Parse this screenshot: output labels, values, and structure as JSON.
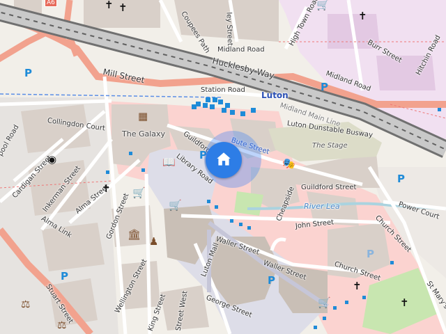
{
  "map": {
    "streets": {
      "coupees_path": "Coupees Path",
      "midland_road_north": "Midland Road",
      "high_town_road": "High Town Road",
      "burr_street": "Burr Street",
      "hitchin_road": "Hitchin Road",
      "hucklesby_way": "Hucklesby Way",
      "midland_road_east": "Midland Road",
      "mill_street": "Mill Street",
      "station_road": "Station Road",
      "midland_main_line": "Midland Main Line",
      "collingdon_court": "Collingdon Court",
      "guildford_street_west": "Guildford Street",
      "bute_street": "Bute Street",
      "luton_dunstable_busway": "Luton Dunstable Busway",
      "library_road": "Library Road",
      "guildford_street_east": "Guildford Street",
      "power_court": "Power Court",
      "cardigan_street": "Cardigan Street",
      "inkerman_street": "Inkerman Street",
      "alma_street": "Alma Street",
      "cheapside": "Cheapside",
      "alma_link": "Alma Link",
      "gordon_street": "Gordon Street",
      "john_street": "John Street",
      "church_street": "Church Street",
      "waller_street_west": "Waller Street",
      "waller_street_east": "Waller Street",
      "luton_mall": "Luton Mall",
      "church_street_lower": "Church Street",
      "wellington_street": "Wellington Street",
      "stuart_street": "Stuart Street",
      "george_street": "George Street",
      "king_street": "King Street",
      "street_west": "Street West",
      "st_marys": "St Mary's",
      "ley_street": "ley Street",
      "pool_road": "pool Road",
      "a6_ref": "A6"
    },
    "places": {
      "the_galaxy": "The Galaxy",
      "the_stage": "The Stage",
      "river_lea": "River Lea",
      "luton_station": "Luton"
    },
    "parking_symbol": "P",
    "colors": {
      "background": "#f2efe9",
      "building": "#d9d0c9",
      "building_dark": "#c9bfb6",
      "pedestrian": "#dddde8",
      "retail": "#fbd3d0",
      "residential": "#e0dfdf",
      "primary_road": "#f2a28e",
      "railway": "#707070",
      "water": "#aad3df",
      "park": "#c8e6b0",
      "stage_area": "#dcdcc8",
      "marker_blue": "#2d7de6",
      "parking_blue": "#1e8bd8",
      "university": "#f1e0f1"
    },
    "icons": {
      "cross": "✝",
      "shop": "🛒",
      "cinema": "▦",
      "library": "📖",
      "theatre": "🎭",
      "courthouse": "⚖",
      "museum": "🏛"
    }
  }
}
